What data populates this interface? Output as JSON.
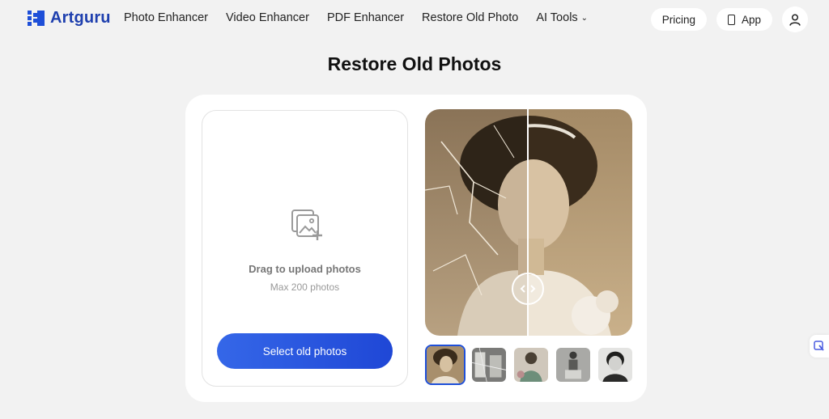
{
  "brand": {
    "name": "Artguru",
    "accent": "#1e4fd8"
  },
  "nav": {
    "links": [
      {
        "label": "Photo Enhancer"
      },
      {
        "label": "Video Enhancer"
      },
      {
        "label": "PDF Enhancer"
      },
      {
        "label": "Restore Old Photo"
      },
      {
        "label": "AI Tools"
      }
    ],
    "pricing_label": "Pricing",
    "app_label": "App"
  },
  "page": {
    "title": "Restore Old Photos"
  },
  "upload": {
    "title": "Drag to upload photos",
    "subtitle": "Max 200 photos",
    "button_label": "Select old photos"
  },
  "icons": {
    "logo": "artguru-logo-icon",
    "chevron": "chevron-down-icon",
    "phone": "phone-icon",
    "user": "user-icon",
    "upload": "image-upload-icon",
    "slider": "compare-slider-icon",
    "side": "feedback-icon"
  }
}
